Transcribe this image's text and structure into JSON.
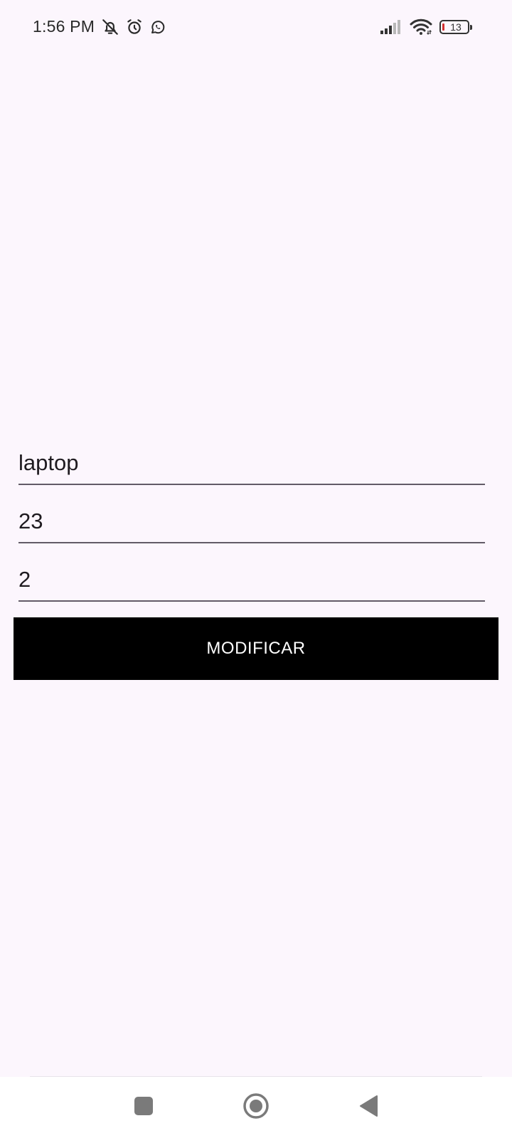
{
  "status_bar": {
    "time": "1:56 PM",
    "left_icons": [
      "bell-off-icon",
      "alarm-icon",
      "whatsapp-icon"
    ],
    "right_icons": [
      "cellular-signal-icon",
      "wifi-icon",
      "battery-icon"
    ],
    "battery_level": "13",
    "battery_color": "#d32f2f"
  },
  "form": {
    "fields": [
      {
        "value": "laptop"
      },
      {
        "value": "23"
      },
      {
        "value": "2"
      }
    ],
    "submit_label": "MODIFICAR",
    "button_color": "#000000"
  },
  "navigation": {
    "buttons": [
      "recents-icon",
      "home-icon",
      "back-icon"
    ]
  },
  "colors": {
    "background": "#fcf6fd",
    "underline": "#625b67"
  }
}
